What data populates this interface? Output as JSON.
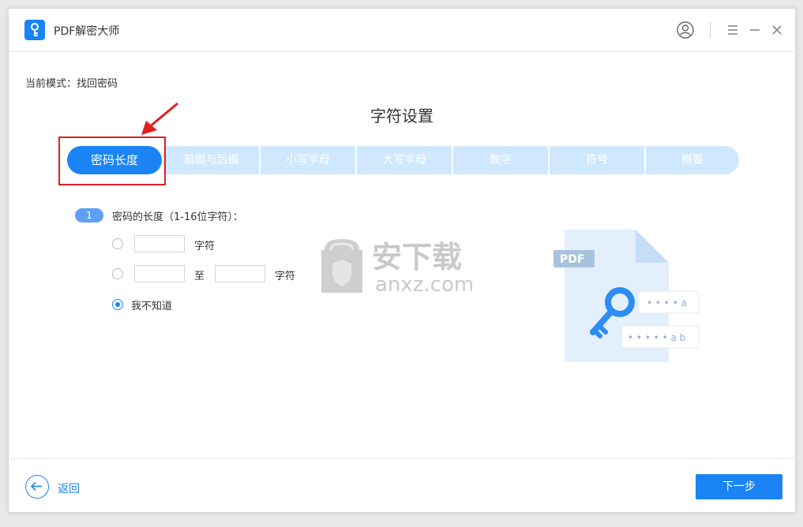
{
  "app": {
    "title": "PDF解密大师",
    "logo_icon": "key-icon"
  },
  "titlebar": {
    "user_icon": "user-icon",
    "menu_icon": "menu-icon",
    "minimize_icon": "minimize-icon",
    "close_icon": "close-icon"
  },
  "mode": {
    "label": "当前模式：找回密码"
  },
  "section": {
    "title": "字符设置"
  },
  "steps": [
    {
      "label": "密码长度",
      "active": true
    },
    {
      "label": "前缀与后缀",
      "active": false
    },
    {
      "label": "小写字母",
      "active": false
    },
    {
      "label": "大写字母",
      "active": false
    },
    {
      "label": "数字",
      "active": false
    },
    {
      "label": "符号",
      "active": false
    },
    {
      "label": "概要",
      "active": false
    }
  ],
  "question": {
    "number": "1",
    "text": "密码的长度（1-16位字符）：",
    "options": {
      "exact": {
        "value": "",
        "unit": "字符",
        "selected": false
      },
      "range": {
        "from": "",
        "to": "",
        "separator": "至",
        "unit": "字符",
        "selected": false
      },
      "unknown": {
        "label": "我不知道",
        "selected": true
      }
    }
  },
  "illustration": {
    "pdf_label": "PDF",
    "row1": "• • • • a",
    "row2": "• • • • • a b"
  },
  "watermark": {
    "text_cn": "安下载",
    "text_en": "anxz.com"
  },
  "footer": {
    "back_label": "返回",
    "next_label": "下一步"
  },
  "colors": {
    "accent": "#1a84f4",
    "step_inactive": "#cfe8fd",
    "highlight": "#e02020"
  }
}
